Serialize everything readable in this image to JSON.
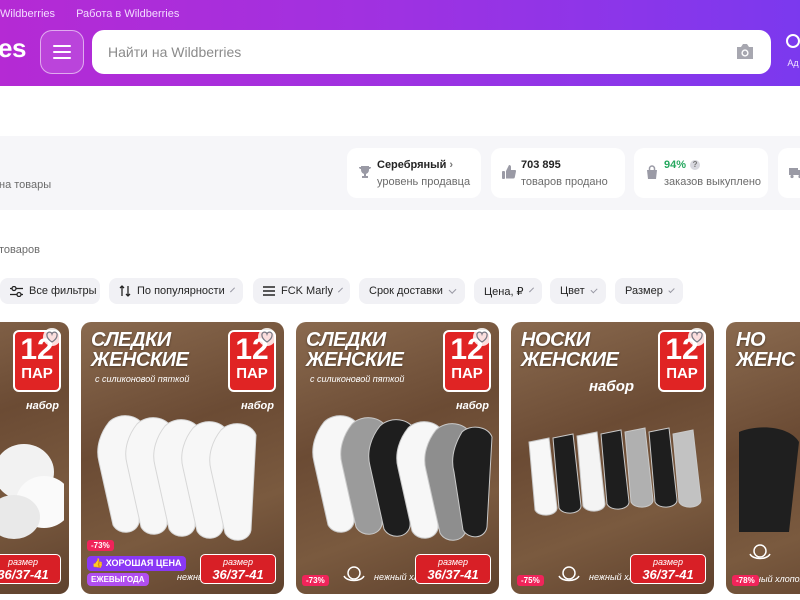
{
  "header": {
    "top_links": [
      "Wildberries",
      "Работа в Wildberries"
    ],
    "logo_text": "es",
    "search_placeholder": "Найти на Wildberries",
    "edge_label": "Ад"
  },
  "seller_strip": {
    "hint": "на товары",
    "stats": [
      {
        "value": "Серебряный",
        "label": "уровень продавца",
        "icon": "trophy-icon"
      },
      {
        "value": "703 895",
        "label": "товаров продано",
        "icon": "thumbs-up-icon"
      },
      {
        "value": "94%",
        "label": "заказов выкуплено",
        "icon": "bag-icon"
      }
    ]
  },
  "product_count_text": "товаров",
  "filters": [
    {
      "label": "Все фильтры",
      "icon": "filter-sliders-icon"
    },
    {
      "label": "По популярности",
      "icon": "sort-icon"
    },
    {
      "label": "FCK Marly",
      "icon": "list-icon"
    },
    {
      "label": "Срок доставки"
    },
    {
      "label": "Цена, ₽"
    },
    {
      "label": "Цвет"
    },
    {
      "label": "Размер"
    }
  ],
  "products": [
    {
      "title": "",
      "pack": "12",
      "pack_unit": "ПАР",
      "nabor": "набор",
      "size_label": "размер",
      "size": "36/37-41",
      "discount": ""
    },
    {
      "title": "СЛЕДКИ ЖЕНСКИЕ",
      "subtitle": "с силиконовой пяткой",
      "pack": "12",
      "pack_unit": "ПАР",
      "nabor": "набор",
      "size_label": "размер",
      "size": "36/37-41",
      "discount": "-73%",
      "promo_line1": "ХОРОШАЯ ЦЕНА",
      "promo_line2": "ЕЖЕВЫГОДА",
      "cotton": "нежный хлопок"
    },
    {
      "title": "СЛЕДКИ ЖЕНСКИЕ",
      "subtitle": "с силиконовой пяткой",
      "pack": "12",
      "pack_unit": "ПАР",
      "nabor": "набор",
      "size_label": "размер",
      "size": "36/37-41",
      "discount": "-73%",
      "cotton": "нежный хлопок"
    },
    {
      "title": "НОСКИ ЖЕНСКИЕ",
      "subtitle": "набор",
      "pack": "12",
      "pack_unit": "ПАР",
      "size_label": "размер",
      "size": "36/37-41",
      "discount": "-75%",
      "cotton": "нежный хлопок"
    },
    {
      "title": "НО ЖЕНС",
      "discount": "-78%",
      "cotton": "нежный хлопок"
    }
  ]
}
